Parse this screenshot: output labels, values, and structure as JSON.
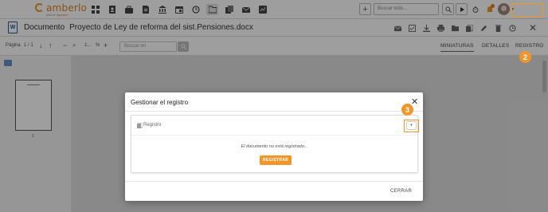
{
  "app": {
    "logo_text": "amberlo",
    "logo_sub": "part of",
    "logo_sub_brand": "dipcorer"
  },
  "topbar": {
    "nav_icons": [
      "dashboard-icon",
      "contacts-icon",
      "briefcase-icon",
      "document-icon",
      "bank-icon",
      "calendar-icon",
      "history-icon",
      "folder-icon",
      "files-icon",
      "mail-icon",
      "reports-icon"
    ],
    "search_placeholder": "Buscar todo...",
    "add_label": "+"
  },
  "document": {
    "label": "Documento",
    "name": "Proyecto de Ley de reforma del sist.Pensiones.docx",
    "actions": [
      "mail-icon",
      "check-icon",
      "download-icon",
      "print-icon",
      "folder-move-icon",
      "copy-icon",
      "edit-icon",
      "delete-icon",
      "history-icon"
    ],
    "close_label": "✕"
  },
  "toolbar": {
    "page_label": "Página",
    "page_value": "1 / 1",
    "zoom_value": "1...",
    "zoom_unit": "%",
    "search_placeholder": "Buscar en",
    "tabs": [
      {
        "label": "MINIATURAS",
        "active": true
      },
      {
        "label": "DETALLES",
        "active": false
      },
      {
        "label": "REGISTRO",
        "active": false
      }
    ]
  },
  "thumbnails": {
    "page_number": "1"
  },
  "modal": {
    "title": "Gestionar el registro",
    "close_label": "✕",
    "card_title": "Registro",
    "add_label": "+",
    "message": "El documento no está registrado...",
    "register_button": "REGISTRAR",
    "cancel_button": "CERRAR"
  },
  "callouts": {
    "step_registro_tab": "2",
    "step_add_button": "3"
  },
  "colors": {
    "accent": "#f0962a",
    "word_blue": "#2b579a"
  }
}
